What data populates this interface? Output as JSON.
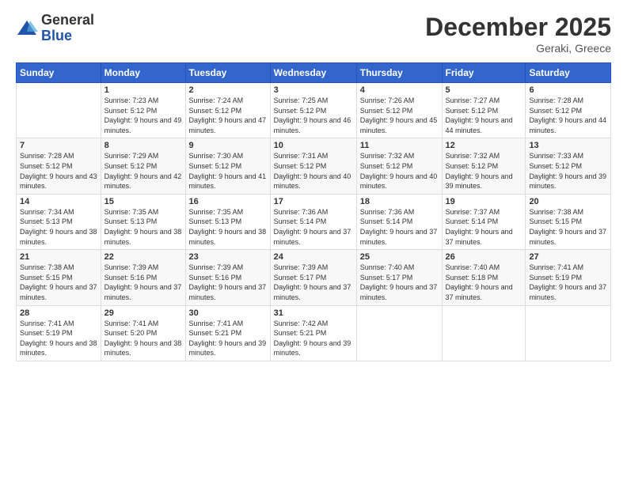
{
  "logo": {
    "general": "General",
    "blue": "Blue"
  },
  "title": "December 2025",
  "location": "Geraki, Greece",
  "days_header": [
    "Sunday",
    "Monday",
    "Tuesday",
    "Wednesday",
    "Thursday",
    "Friday",
    "Saturday"
  ],
  "weeks": [
    [
      {
        "day": "",
        "sunrise": "",
        "sunset": "",
        "daylight": ""
      },
      {
        "day": "1",
        "sunrise": "7:23 AM",
        "sunset": "5:12 PM",
        "daylight": "9 hours and 49 minutes."
      },
      {
        "day": "2",
        "sunrise": "7:24 AM",
        "sunset": "5:12 PM",
        "daylight": "9 hours and 47 minutes."
      },
      {
        "day": "3",
        "sunrise": "7:25 AM",
        "sunset": "5:12 PM",
        "daylight": "9 hours and 46 minutes."
      },
      {
        "day": "4",
        "sunrise": "7:26 AM",
        "sunset": "5:12 PM",
        "daylight": "9 hours and 45 minutes."
      },
      {
        "day": "5",
        "sunrise": "7:27 AM",
        "sunset": "5:12 PM",
        "daylight": "9 hours and 44 minutes."
      },
      {
        "day": "6",
        "sunrise": "7:28 AM",
        "sunset": "5:12 PM",
        "daylight": "9 hours and 44 minutes."
      }
    ],
    [
      {
        "day": "7",
        "sunrise": "7:28 AM",
        "sunset": "5:12 PM",
        "daylight": "9 hours and 43 minutes."
      },
      {
        "day": "8",
        "sunrise": "7:29 AM",
        "sunset": "5:12 PM",
        "daylight": "9 hours and 42 minutes."
      },
      {
        "day": "9",
        "sunrise": "7:30 AM",
        "sunset": "5:12 PM",
        "daylight": "9 hours and 41 minutes."
      },
      {
        "day": "10",
        "sunrise": "7:31 AM",
        "sunset": "5:12 PM",
        "daylight": "9 hours and 40 minutes."
      },
      {
        "day": "11",
        "sunrise": "7:32 AM",
        "sunset": "5:12 PM",
        "daylight": "9 hours and 40 minutes."
      },
      {
        "day": "12",
        "sunrise": "7:32 AM",
        "sunset": "5:12 PM",
        "daylight": "9 hours and 39 minutes."
      },
      {
        "day": "13",
        "sunrise": "7:33 AM",
        "sunset": "5:12 PM",
        "daylight": "9 hours and 39 minutes."
      }
    ],
    [
      {
        "day": "14",
        "sunrise": "7:34 AM",
        "sunset": "5:13 PM",
        "daylight": "9 hours and 38 minutes."
      },
      {
        "day": "15",
        "sunrise": "7:35 AM",
        "sunset": "5:13 PM",
        "daylight": "9 hours and 38 minutes."
      },
      {
        "day": "16",
        "sunrise": "7:35 AM",
        "sunset": "5:13 PM",
        "daylight": "9 hours and 38 minutes."
      },
      {
        "day": "17",
        "sunrise": "7:36 AM",
        "sunset": "5:14 PM",
        "daylight": "9 hours and 37 minutes."
      },
      {
        "day": "18",
        "sunrise": "7:36 AM",
        "sunset": "5:14 PM",
        "daylight": "9 hours and 37 minutes."
      },
      {
        "day": "19",
        "sunrise": "7:37 AM",
        "sunset": "5:14 PM",
        "daylight": "9 hours and 37 minutes."
      },
      {
        "day": "20",
        "sunrise": "7:38 AM",
        "sunset": "5:15 PM",
        "daylight": "9 hours and 37 minutes."
      }
    ],
    [
      {
        "day": "21",
        "sunrise": "7:38 AM",
        "sunset": "5:15 PM",
        "daylight": "9 hours and 37 minutes."
      },
      {
        "day": "22",
        "sunrise": "7:39 AM",
        "sunset": "5:16 PM",
        "daylight": "9 hours and 37 minutes."
      },
      {
        "day": "23",
        "sunrise": "7:39 AM",
        "sunset": "5:16 PM",
        "daylight": "9 hours and 37 minutes."
      },
      {
        "day": "24",
        "sunrise": "7:39 AM",
        "sunset": "5:17 PM",
        "daylight": "9 hours and 37 minutes."
      },
      {
        "day": "25",
        "sunrise": "7:40 AM",
        "sunset": "5:17 PM",
        "daylight": "9 hours and 37 minutes."
      },
      {
        "day": "26",
        "sunrise": "7:40 AM",
        "sunset": "5:18 PM",
        "daylight": "9 hours and 37 minutes."
      },
      {
        "day": "27",
        "sunrise": "7:41 AM",
        "sunset": "5:19 PM",
        "daylight": "9 hours and 37 minutes."
      }
    ],
    [
      {
        "day": "28",
        "sunrise": "7:41 AM",
        "sunset": "5:19 PM",
        "daylight": "9 hours and 38 minutes."
      },
      {
        "day": "29",
        "sunrise": "7:41 AM",
        "sunset": "5:20 PM",
        "daylight": "9 hours and 38 minutes."
      },
      {
        "day": "30",
        "sunrise": "7:41 AM",
        "sunset": "5:21 PM",
        "daylight": "9 hours and 39 minutes."
      },
      {
        "day": "31",
        "sunrise": "7:42 AM",
        "sunset": "5:21 PM",
        "daylight": "9 hours and 39 minutes."
      },
      {
        "day": "",
        "sunrise": "",
        "sunset": "",
        "daylight": ""
      },
      {
        "day": "",
        "sunrise": "",
        "sunset": "",
        "daylight": ""
      },
      {
        "day": "",
        "sunrise": "",
        "sunset": "",
        "daylight": ""
      }
    ]
  ]
}
